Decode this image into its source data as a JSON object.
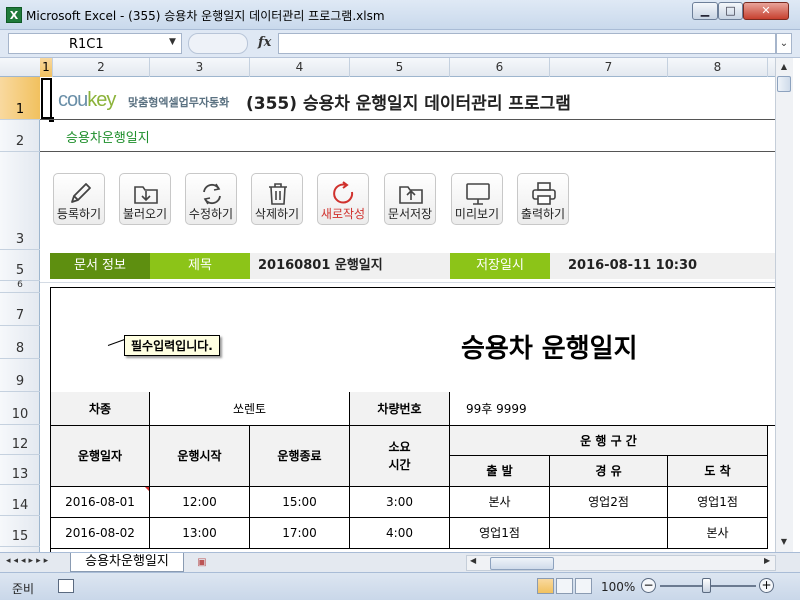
{
  "window": {
    "title": "Microsoft Excel - (355) 승용차 운행일지 데이터관리 프로그램.xlsm",
    "app_icon_letter": "X",
    "min_icon": "minimize-icon",
    "max_icon": "maximize-icon",
    "close_icon": "close-icon",
    "min_glyph": "▁",
    "max_glyph": "□",
    "close_glyph": "✕"
  },
  "formula_bar": {
    "name_box": "R1C1",
    "fx_label": "fx",
    "formula": ""
  },
  "columns": [
    "1",
    "2",
    "3",
    "4",
    "5",
    "6",
    "7",
    "8"
  ],
  "rows": [
    "1",
    "2",
    "3",
    "5",
    "6",
    "7",
    "8",
    "9",
    "10",
    "12",
    "13",
    "14",
    "15"
  ],
  "header": {
    "logo_prefix": "cou",
    "logo_suffix": "key",
    "tagline": "맞춤형엑셀업무자동화",
    "doc_title": "(355) 승용차 운행일지 데이터관리 프로그램",
    "subtitle": "승용차운행일지"
  },
  "toolbar": {
    "buttons": [
      {
        "label": "등록하기",
        "icon": "pencil-icon"
      },
      {
        "label": "불러오기",
        "icon": "folder-download-icon"
      },
      {
        "label": "수정하기",
        "icon": "refresh-icon"
      },
      {
        "label": "삭제하기",
        "icon": "trash-icon"
      },
      {
        "label": "새로작성",
        "icon": "new-document-icon"
      },
      {
        "label": "문서저장",
        "icon": "folder-upload-icon"
      },
      {
        "label": "미리보기",
        "icon": "monitor-icon"
      },
      {
        "label": "출력하기",
        "icon": "printer-icon"
      }
    ]
  },
  "info_bar": {
    "doc_info_label": "문서 정보",
    "title_label": "제목",
    "title_value": "20160801 운행일지",
    "saved_label": "저장일시",
    "saved_value": "2016-08-11 10:30"
  },
  "form": {
    "title": "승용차 운행일지",
    "car_label": "차종",
    "car_value": "쏘렌토",
    "plate_label": "차량번호",
    "plate_value": "99후 9999",
    "headers": {
      "date": "운행일자",
      "start": "운행시작",
      "end": "운행종료",
      "duration_line1": "소요",
      "duration_line2": "시간",
      "route": "운 행 구 간",
      "depart": "출 발",
      "via": "경 유",
      "arrive": "도 착"
    },
    "rows": [
      {
        "date": "2016-08-01",
        "start": "12:00",
        "end": "15:00",
        "duration": "3:00",
        "depart": "본사",
        "via": "영업2점",
        "arrive": "영업1점"
      },
      {
        "date": "2016-08-02",
        "start": "13:00",
        "end": "17:00",
        "duration": "4:00",
        "depart": "영업1점",
        "via": "",
        "arrive": "본사"
      }
    ]
  },
  "tooltip": "필수입력입니다.",
  "sheet_tab": "승용차운행일지",
  "sheet_nav": "◂◂◂▸▸▸",
  "status": {
    "ready": "준비",
    "zoom": "100%",
    "zoom_minus": "−",
    "zoom_plus": "+"
  }
}
